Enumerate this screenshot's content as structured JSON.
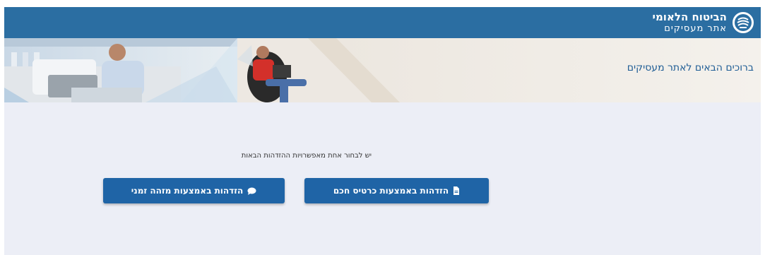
{
  "header": {
    "title": "הביטוח הלאומי",
    "subtitle": "אתר מעסיקים",
    "logo_icon": "national-insurance-logo-icon"
  },
  "banner": {
    "welcome_text": "ברוכים הבאים לאתר מעסיקים"
  },
  "main": {
    "prompt": "יש לבחור אחת מאפשרויות ההזדהות הבאות",
    "smart_card_button": {
      "label": "הזדהות באמצעות כרטיס חכם",
      "icon": "document-icon"
    },
    "temp_id_button": {
      "label": "הזדהות באמצעות מזהה זמני",
      "icon": "chat-bubble-icon"
    }
  },
  "colors": {
    "header_bg": "#2b6ea2",
    "content_bg": "#eceef6",
    "button_bg": "#1f64a6",
    "welcome_text": "#1f5d95"
  }
}
